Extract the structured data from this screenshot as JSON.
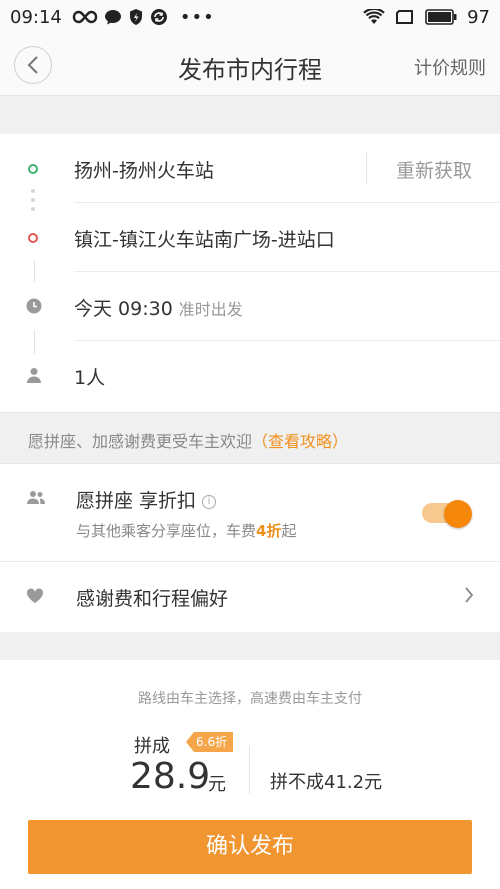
{
  "status_bar": {
    "time": "09:14",
    "battery": "97",
    "icons": [
      "infinity-icon",
      "chat-bubble-icon",
      "shield-icon",
      "vpn-icon",
      "more-dots-icon",
      "wifi-icon",
      "screen-icon",
      "battery-icon"
    ]
  },
  "header": {
    "title": "发布市内行程",
    "right_link": "计价规则"
  },
  "route": {
    "start": "扬州-扬州火车站",
    "refresh": "重新获取",
    "end": "镇江-镇江火车站南广场-进站口",
    "time": "今天 09:30",
    "time_note": "准时出发",
    "passengers": "1人"
  },
  "tip": {
    "text": "愿拼座、加感谢费更受车主欢迎",
    "link": "（查看攻略）"
  },
  "options": {
    "carpool_title": "愿拼座 享折扣",
    "carpool_sub_before": "与其他乘客分享座位，车费",
    "carpool_sub_discount": "4折",
    "carpool_sub_after": "起",
    "carpool_enabled": true,
    "thanks_title": "感谢费和行程偏好"
  },
  "fare": {
    "note": "路线由车主选择，高速费由车主支付",
    "pin_label": "拼成",
    "discount_badge": "6.6折",
    "price": "28.9",
    "unit": "元",
    "alt": "拼不成41.2元"
  },
  "confirm_button": "确认发布",
  "colors": {
    "accent": "#f0952f",
    "start_dot": "#3cb46e",
    "end_dot": "#e05a50"
  }
}
